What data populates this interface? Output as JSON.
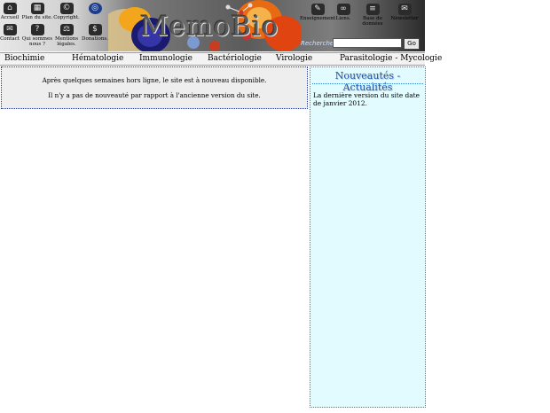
{
  "header": {
    "logo_text": "MemoBio",
    "icons_left": [
      {
        "label": "Accueil",
        "icon": "home-icon"
      },
      {
        "label": "Plan du site.",
        "icon": "sitemap-icon"
      },
      {
        "label": "Copyright.",
        "icon": "copyright-icon"
      },
      {
        "label": "",
        "icon": "sfbm-logo-icon"
      },
      {
        "label": "Contact",
        "icon": "mail-icon"
      },
      {
        "label": "Qui sommes nous ?",
        "icon": "question-icon"
      },
      {
        "label": "Mentions légales.",
        "icon": "scales-icon"
      },
      {
        "label": "Donations.",
        "icon": "donation-icon"
      }
    ],
    "icons_right": [
      {
        "label": "Enseignement",
        "icon": "teaching-icon"
      },
      {
        "label": "Liens.",
        "icon": "links-icon"
      },
      {
        "label": "Base de données",
        "icon": "database-icon"
      },
      {
        "label": "Newsletter",
        "icon": "newsletter-icon"
      }
    ],
    "search": {
      "label": "Recherche :",
      "placeholder": "",
      "button": "Go"
    }
  },
  "nav": [
    "Biochimie",
    "Hématologie",
    "Immunologie",
    "Bactériologie",
    "Virologie",
    "Parasitologie - Mycologie"
  ],
  "notice": {
    "line1": "Après quelques semaines hors ligne, le site est à nouveau disponible.",
    "line2": "Il n'y a pas de nouveauté par rapport à l'ancienne version du site."
  },
  "news": {
    "title": "Nouveautés - Actualités",
    "body": "La dernière version du site date de janvier 2012."
  }
}
